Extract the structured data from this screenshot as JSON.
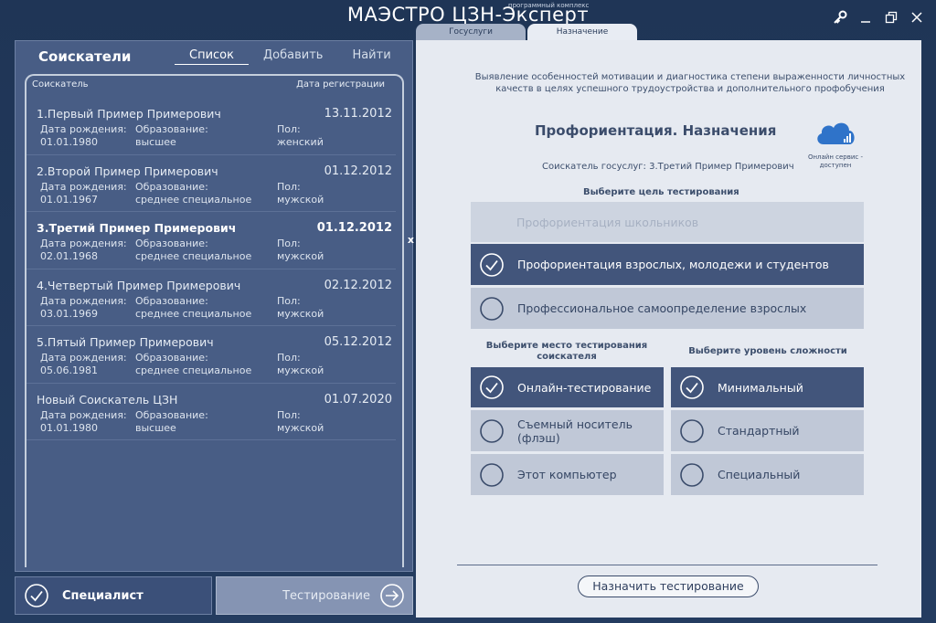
{
  "app": {
    "title": "МАЭСТРО ЦЗН-Эксперт",
    "subtitle": "программный комплекс"
  },
  "window_controls": [
    "key-icon",
    "minimize-icon",
    "restore-icon",
    "close-icon"
  ],
  "left": {
    "title": "Соискатели",
    "tabs": [
      {
        "label": "Список",
        "active": true
      },
      {
        "label": "Добавить",
        "active": false
      },
      {
        "label": "Найти",
        "active": false
      }
    ],
    "columns": {
      "name": "Соискатель",
      "date": "Дата регистрации"
    },
    "labels": {
      "birth": "Дата рождения:",
      "education": "Образование:",
      "gender": "Пол:"
    },
    "rows": [
      {
        "name": "1.Первый Пример Примерович",
        "date": "13.11.2012",
        "birth": "01.01.1980",
        "education": "высшее",
        "gender": "женский"
      },
      {
        "name": "2.Второй Пример Примерович",
        "date": "01.12.2012",
        "birth": "01.01.1967",
        "education": "среднее специальное",
        "gender": "мужской"
      },
      {
        "name": "3.Третий Пример Примерович",
        "date": "01.12.2012",
        "birth": "02.01.1968",
        "education": "среднее специальное",
        "gender": "мужской"
      },
      {
        "name": "4.Четвертый Пример Примерович",
        "date": "02.12.2012",
        "birth": "03.01.1969",
        "education": "среднее специальное",
        "gender": "мужской"
      },
      {
        "name": "5.Пятый Пример Примерович",
        "date": "05.12.2012",
        "birth": "05.06.1981",
        "education": "среднее специальное",
        "gender": "мужской"
      },
      {
        "name": "Новый Соискатель ЦЗН",
        "date": "01.07.2020",
        "birth": "01.01.1980",
        "education": "высшее",
        "gender": "мужской"
      }
    ],
    "row_close": "x",
    "specialist_label": "Специалист",
    "testing_label": "Тестирование"
  },
  "right": {
    "tabs": [
      {
        "label": "Госуслуги",
        "active": false
      },
      {
        "label": "Назначение",
        "active": true
      }
    ],
    "description": "Выявление особенностей мотивации и диагностика степени выраженности личностных качеств в целях успешного трудоустройства и дополнительного профобучения",
    "section_title": "Профориентация. Назначения",
    "cloud_text": "Онлайн сервис - доступен",
    "seeker": "Соискатель госуслуг: 3.Третий Пример Примерович",
    "goal_title": "Выберите цель тестирования",
    "goals": [
      {
        "label": "Профориентация школьников",
        "state": "disabled"
      },
      {
        "label": "Профориентация взрослых, молодежи и студентов",
        "state": "selected"
      },
      {
        "label": "Профессиональное самоопределение взрослых",
        "state": "normal"
      }
    ],
    "place_title": "Выберите место тестирования соискателя",
    "places": [
      {
        "label": "Онлайн-тестирование",
        "state": "selected"
      },
      {
        "label": "Съемный носитель (флэш)",
        "state": "normal"
      },
      {
        "label": "Этот компьютер",
        "state": "normal"
      }
    ],
    "level_title": "Выберите уровень сложности",
    "levels": [
      {
        "label": "Минимальный",
        "state": "selected"
      },
      {
        "label": "Стандартный",
        "state": "normal"
      },
      {
        "label": "Специальный",
        "state": "normal"
      }
    ],
    "assign_button": "Назначить тестирование"
  }
}
